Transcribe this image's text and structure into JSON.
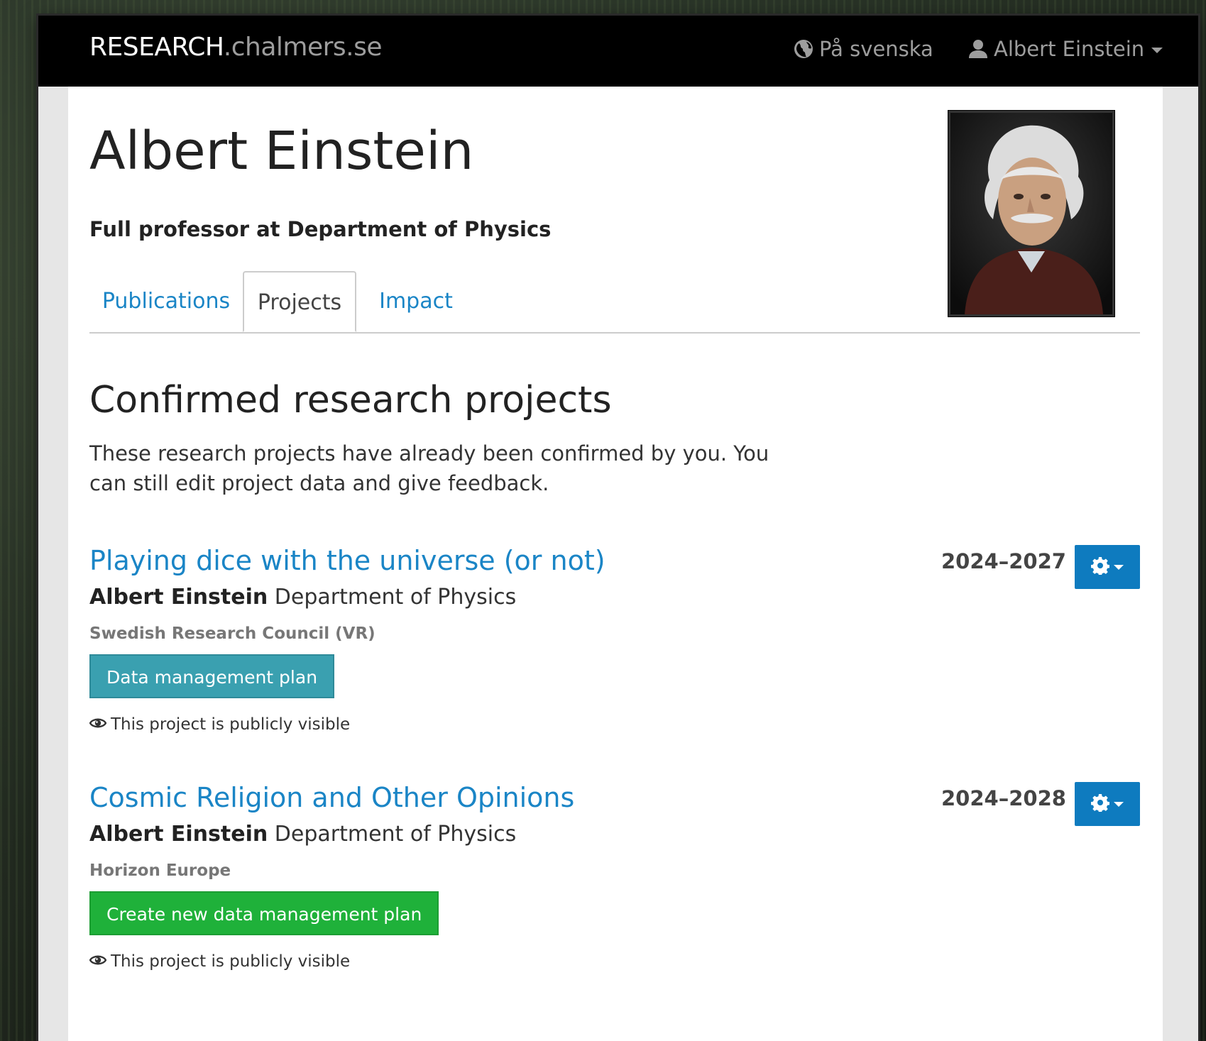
{
  "navbar": {
    "brand_main": "RESEARCH",
    "brand_domain": ".chalmers.se",
    "language_link": "På svenska",
    "user_menu": "Albert Einstein"
  },
  "profile": {
    "name": "Albert Einstein",
    "position": "Full professor at Department of Physics"
  },
  "tabs": [
    {
      "label": "Publications",
      "active": false
    },
    {
      "label": "Projects",
      "active": true
    },
    {
      "label": "Impact",
      "active": false
    }
  ],
  "section": {
    "title": "Confirmed research projects",
    "description": "These research projects have already been confirmed by you. You can still edit project data and give feedback."
  },
  "projects": [
    {
      "title": "Playing dice with the universe (or not)",
      "person": "Albert Einstein",
      "department": "Department of Physics",
      "funder": "Swedish Research Council (VR)",
      "years": "2024–2027",
      "dmp_button": "Data management plan",
      "visibility": "This project is publicly visible"
    },
    {
      "title": "Cosmic Religion and Other Opinions",
      "person": "Albert Einstein",
      "department": "Department of Physics",
      "funder": "Horizon Europe",
      "years": "2024–2028",
      "dmp_button": "Create new data management plan",
      "visibility": "This project is publicly visible"
    }
  ],
  "icons": {
    "language": "globe-icon",
    "user": "user-icon",
    "settings": "gear-icon",
    "visibility": "eye-icon"
  },
  "colors": {
    "link": "#1a85c6",
    "navbar": "#000000",
    "gear_button": "#0e7bbf",
    "dmp_existing": "#3aa0b0",
    "dmp_create": "#1fb13a"
  }
}
